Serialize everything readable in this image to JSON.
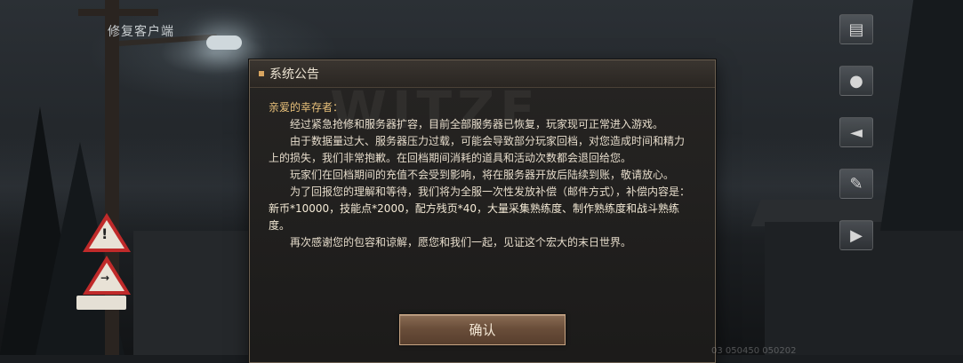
{
  "topbar": {
    "repair_client": "修复客户端"
  },
  "side_icons": [
    {
      "icon": "notice-board-icon"
    },
    {
      "icon": "user-profile-icon"
    },
    {
      "icon": "speaker-announcement-icon"
    },
    {
      "icon": "edit-note-icon"
    },
    {
      "icon": "video-play-icon"
    }
  ],
  "dialog": {
    "title": "系统公告",
    "watermark": "WITZE",
    "greeting": "亲爱的幸存者：",
    "paragraphs": {
      "p1": "经过紧急抢修和服务器扩容，目前全部服务器已恢复，玩家现可正常进入游戏。",
      "p2": "由于数据量过大、服务器压力过载，可能会导致部分玩家回档，对您造成时间和精力上的损失，我们非常抱歉。在回档期间消耗的道具和活动次数都会退回给您。",
      "p3": "玩家们在回档期间的充值不会受到影响，将在服务器开放后陆续到账，敬请放心。",
      "p4_intro": "为了回报您的理解和等待，我们将为全服一次性发放补偿（邮件方式），补偿内容是：",
      "p4_reward": "新币*10000，技能点*2000，配方残页*40，大量采集熟练度、制作熟练度和战斗熟练度。",
      "p5": "再次感谢您的包容和谅解，愿您和我们一起，见证这个宏大的末日世界。"
    },
    "confirm_label": "确认"
  },
  "footer": {
    "build_text": "03 050450 050202"
  }
}
